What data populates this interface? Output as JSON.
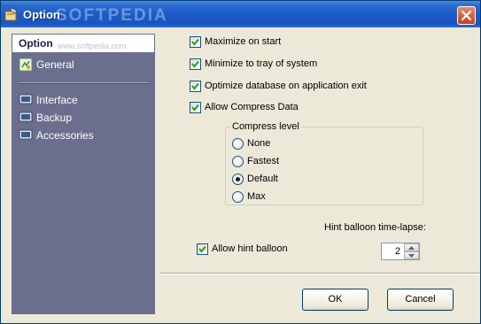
{
  "window": {
    "title": "Option",
    "watermark": "SOFTPEDIA",
    "watermark_url": "www.softpedia.com"
  },
  "sidebar": {
    "header": "Option",
    "items": [
      {
        "label": "General",
        "icon": "general-settings-icon"
      },
      {
        "label": "Interface",
        "icon": "monitor-icon"
      },
      {
        "label": "Backup",
        "icon": "monitor-icon"
      },
      {
        "label": "Accessories",
        "icon": "monitor-icon"
      }
    ]
  },
  "options": {
    "maximize_on_start": {
      "label": "Maximize on start",
      "checked": true
    },
    "minimize_to_tray": {
      "label": "Minimize to tray of system",
      "checked": true
    },
    "optimize_db": {
      "label": "Optimize database on application exit",
      "checked": true
    },
    "allow_compress": {
      "label": "Allow Compress Data",
      "checked": true
    }
  },
  "compress": {
    "title": "Compress level",
    "levels": [
      {
        "label": "None",
        "selected": false
      },
      {
        "label": "Fastest",
        "selected": false
      },
      {
        "label": "Default",
        "selected": true
      },
      {
        "label": "Max",
        "selected": false
      }
    ]
  },
  "hint": {
    "timelapse_label": "Hint balloon time-lapse:",
    "allow_label": "Allow hint balloon",
    "allow_checked": true,
    "timelapse_value": "2"
  },
  "buttons": {
    "ok": "OK",
    "cancel": "Cancel"
  },
  "colors": {
    "titlebar": "#1c5cc8",
    "sidebar": "#6b6f8d",
    "dialog_bg": "#ece9d8"
  }
}
